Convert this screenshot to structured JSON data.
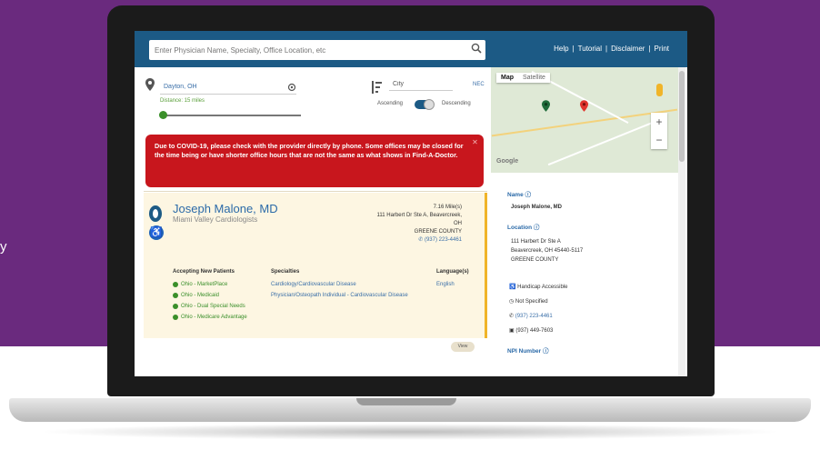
{
  "edge_text": "y",
  "header": {
    "search_placeholder": "Enter Physician Name, Specialty, Office Location, etc",
    "links": [
      "Help",
      "|",
      "Tutorial",
      "|",
      "Disclaimer",
      "|",
      "Print"
    ]
  },
  "filters": {
    "location": "Dayton, OH",
    "distance_label": "Distance: 15 miles",
    "distance_fraction": 0.02,
    "sort_by": "City",
    "nec": "NEC",
    "ascending": "Ascending",
    "descending": "Descending"
  },
  "alert": "Due to COVID-19, please check with the provider directly by phone. Some offices may be closed for the time being or have shorter office hours that are not the same as what shows in Find-A-Doctor.",
  "card": {
    "name": "Joseph Malone, MD",
    "practice": "Miami Valley Cardiologists",
    "distance": "7.16 Mile(s)",
    "address1": "111 Harbert Dr Ste A, Beavercreek,",
    "address2": "OH",
    "county": "GREENE COUNTY",
    "phone": "(937) 223-4461",
    "accepting_header": "Accepting New Patients",
    "specialties_header": "Specialties",
    "languages_header": "Language(s)",
    "plans": [
      "Ohio - MarketPlace",
      "Ohio - Medicaid",
      "Ohio - Dual Special Needs",
      "Ohio - Medicare Advantage"
    ],
    "specialties": [
      "Cardiology/Cardiovascular Disease",
      "Physician/Osteopath Individual - Cardiovascular Disease"
    ],
    "language": "English",
    "view_btn": "View"
  },
  "map": {
    "tab_map": "Map",
    "tab_satellite": "Satellite",
    "zoom_in": "+",
    "zoom_out": "−",
    "attribution": "Google"
  },
  "details": {
    "name_label": "Name",
    "name": "Joseph Malone, MD",
    "location_label": "Location",
    "address1": "111 Harbert Dr Ste A",
    "address2": "Beavercreek, OH 45440-5117",
    "county": "GREENE COUNTY",
    "handicap": "Handicap Accessible",
    "hours": "Not Specified",
    "phone": "(937) 223-4461",
    "fax": "(937) 449-7603",
    "npi_label": "NPI Number"
  },
  "colors": {
    "brand_purple": "#6a2a7e",
    "header_blue": "#1c5a85",
    "alert_red": "#c8161d",
    "card_bg": "#fdf6e2",
    "accent_gold": "#f0b429"
  }
}
